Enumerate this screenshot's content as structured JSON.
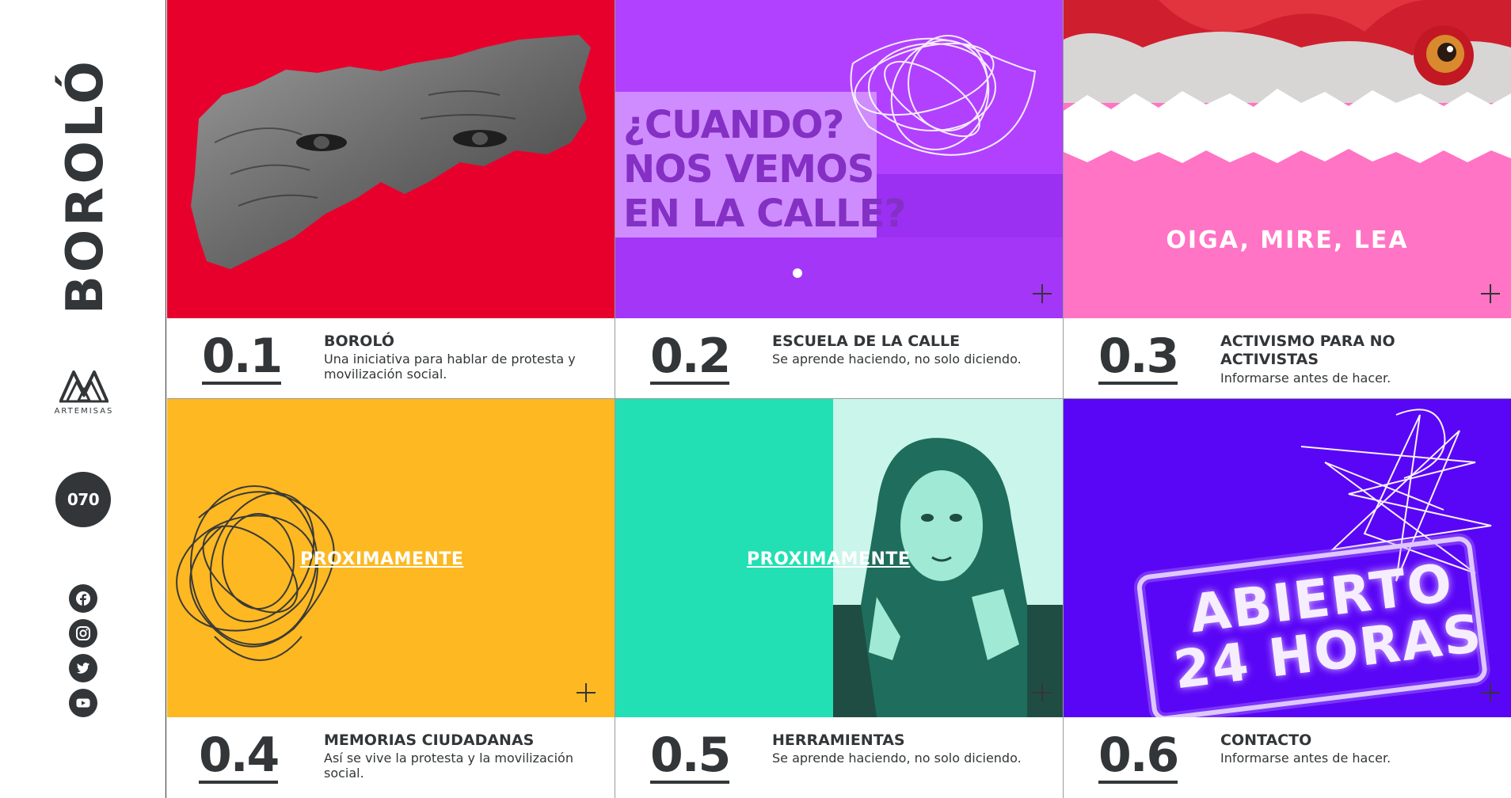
{
  "brand": {
    "logo": "BOROLÓ",
    "partner_name": "ARTEMISAS",
    "counter": "070"
  },
  "social": [
    {
      "icon": "facebook-icon"
    },
    {
      "icon": "instagram-icon"
    },
    {
      "icon": "twitter-icon"
    },
    {
      "icon": "youtube-icon"
    }
  ],
  "colors": {
    "dark": "#323638",
    "red": "#e8002d",
    "violet": "#b141ff",
    "pink": "#ff74c4",
    "yellow": "#fdb822",
    "teal": "#22e0b4",
    "purple": "#5a06f6"
  },
  "cards": [
    {
      "number": "0.1",
      "title": "BOROLÓ",
      "description": "Una iniciativa para hablar de protesta y movilización social."
    },
    {
      "number": "0.2",
      "title": "ESCUELA DE LA CALLE",
      "description": "Se aprende haciendo, no solo diciendo.",
      "sign_text": [
        "¿CUANDO?",
        "NOS VEMOS",
        "EN LA CALLE?"
      ]
    },
    {
      "number": "0.3",
      "title": "ACTIVISMO PARA NO ACTIVISTAS",
      "description": "Informarse antes de hacer.",
      "overlay_text": "OIGA, MIRE, LEA"
    },
    {
      "number": "0.4",
      "title": "MEMORIAS CIUDADANAS",
      "description": "Así se vive la protesta y la movilización social.",
      "overlay_text": "PROXIMAMENTE"
    },
    {
      "number": "0.5",
      "title": "HERRAMIENTAS",
      "description": "Se aprende haciendo, no solo diciendo.",
      "overlay_text": "PROXIMAMENTE"
    },
    {
      "number": "0.6",
      "title": "CONTACTO",
      "description": "Informarse antes de hacer.",
      "neon_text": [
        "ABIERTO",
        "24 HORAS"
      ]
    }
  ]
}
